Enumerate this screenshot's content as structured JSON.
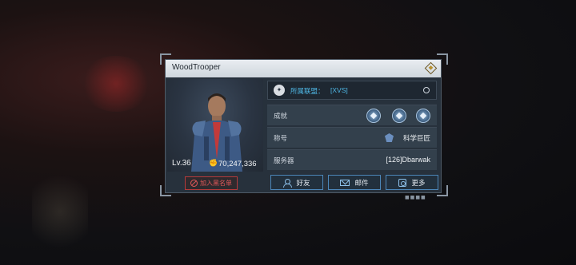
{
  "player": {
    "name": "WoodTrooper",
    "level": "Lv.36",
    "power": "70,247,336"
  },
  "alliance": {
    "label": "所属联盟：",
    "value": "[XVS]"
  },
  "rows": {
    "achievements": {
      "label": "成就",
      "badges": [
        "achievement-badge-1",
        "achievement-badge-2",
        "achievement-badge-3"
      ]
    },
    "title": {
      "label": "称号",
      "value": "科学巨匠"
    },
    "server": {
      "label": "服务器",
      "value": "[126]Dbarwak"
    }
  },
  "buttons": {
    "blacklist": "加入黑名单",
    "friend": "好友",
    "mail": "邮件",
    "more": "更多"
  },
  "colors": {
    "accent_blue": "#4fb8e6",
    "danger_red": "#e05858",
    "panel": "#27313c"
  }
}
